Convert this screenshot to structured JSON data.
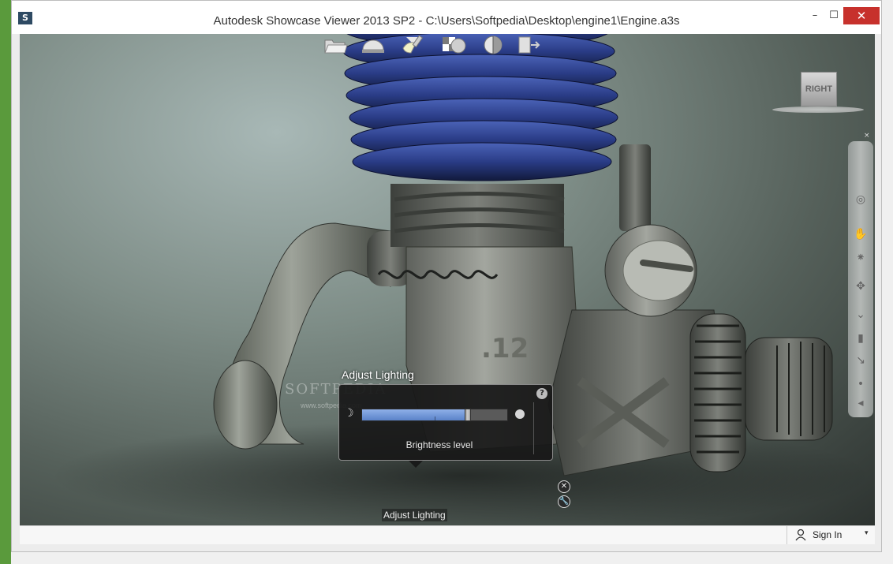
{
  "window": {
    "title": "Autodesk Showcase Viewer 2013 SP2  - C:\\Users\\Softpedia\\Desktop\\engine1\\Engine.a3s",
    "app_icon": "S",
    "minimize": "–",
    "maximize": "☐",
    "close": "✕"
  },
  "viewcube": {
    "face_label": "RIGHT"
  },
  "navbar": {
    "close": "×",
    "icons": [
      "steering-wheel-icon",
      "pan-icon",
      "zoom-icon",
      "orbit-icon",
      "look-icon",
      "walk-icon",
      "center-icon",
      "fly-icon",
      "rewind-icon"
    ]
  },
  "watermark": {
    "text": "SOFTPEDIA",
    "url": "www.softpedia.com"
  },
  "lighting_panel": {
    "title": "Adjust Lighting",
    "help": "?",
    "moon": "☽",
    "brightness_label": "Brightness level",
    "brightness_fraction": 0.72
  },
  "toolbar": {
    "items": [
      {
        "name": "open-file-icon"
      },
      {
        "name": "environment-icon"
      },
      {
        "name": "adjust-lighting-icon"
      },
      {
        "name": "materials-icon"
      },
      {
        "name": "display-mode-icon"
      },
      {
        "name": "exit-icon"
      }
    ],
    "close_glyph": "✕",
    "settings_glyph": "🔧",
    "tooltip": "Adjust Lighting"
  },
  "statusbar": {
    "sign_in": "Sign In",
    "caret": "▾"
  },
  "colors": {
    "close_button": "#c7312c",
    "slider_fill": "#6f93d8",
    "engine_fins": "#2c3f8a",
    "engine_body": "#8a8d85"
  }
}
